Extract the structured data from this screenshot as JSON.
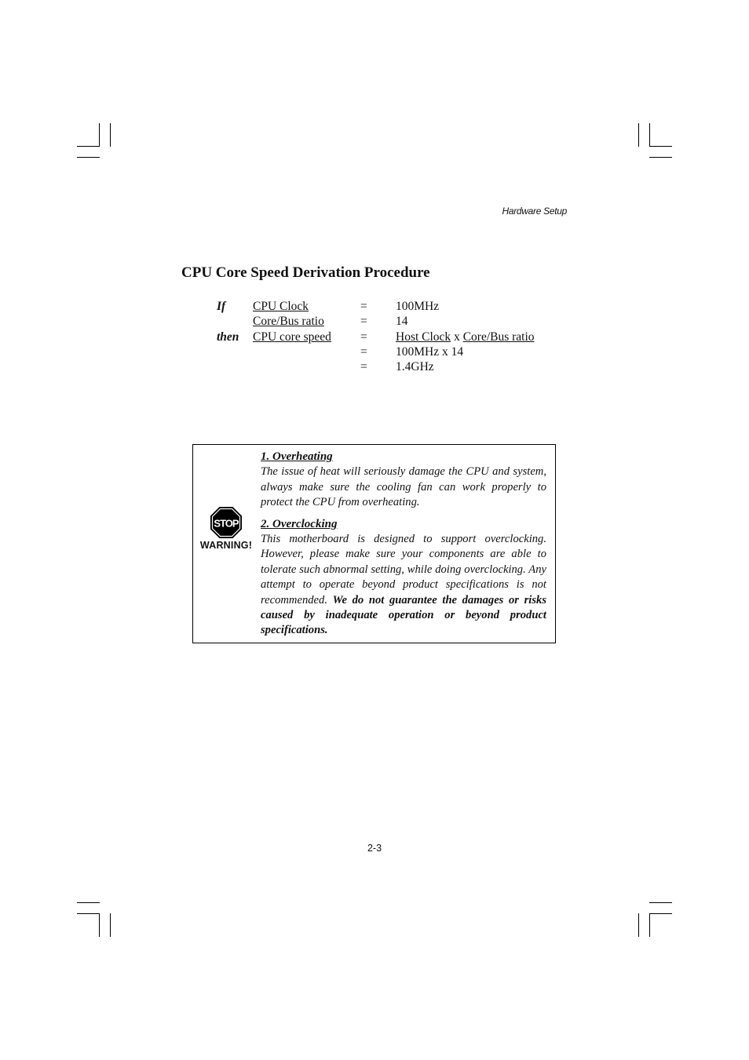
{
  "header": {
    "running_head": "Hardware Setup"
  },
  "section": {
    "title": "CPU Core Speed Derivation Procedure"
  },
  "derivation": {
    "rows": [
      {
        "condition": "If",
        "term": "CPU Clock",
        "eq": "=",
        "value": "100MHz"
      },
      {
        "condition": "",
        "term": "Core/Bus ratio",
        "eq": "=",
        "value": "14"
      },
      {
        "condition": "then",
        "term": "CPU core speed",
        "eq": "=",
        "value_parts": [
          "Host Clock",
          " x ",
          "Core/Bus ratio"
        ]
      },
      {
        "condition": "",
        "term": "",
        "eq": "=",
        "value": "100MHz x 14"
      },
      {
        "condition": "",
        "term": "",
        "eq": "=",
        "value": "1.4GHz"
      }
    ]
  },
  "warning": {
    "icon_text": "STOP",
    "label": "WARNING!",
    "items": [
      {
        "heading": "1. Overheating",
        "body": "The issue of heat will seriously damage the CPU and system, always make sure the cooling fan can work properly to protect the CPU from overheating.",
        "emphasis": ""
      },
      {
        "heading": "2. Overclocking",
        "body": "This motherboard is designed to support overclocking. However, please make sure your components are able to tolerate such abnormal setting, while doing overclocking. Any attempt to operate beyond product specifications is not recommended. ",
        "emphasis": "We do not guarantee the damages or risks caused by inadequate operation or beyond product specifications."
      }
    ]
  },
  "footer": {
    "page_number": "2-3"
  }
}
